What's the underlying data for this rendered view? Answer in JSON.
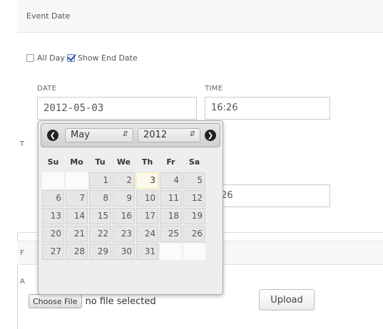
{
  "event_date_section": {
    "title": "Event Date",
    "all_day_label": "All Day",
    "all_day_checked": false,
    "show_end_date_label": "Show End Date",
    "show_end_date_checked": true
  },
  "date_field": {
    "label": "DATE",
    "value": "2012-05-03"
  },
  "time_field": {
    "label": "TIME",
    "value": "16:26"
  },
  "end_time_field": {
    "value_visible": "26"
  },
  "partial_labels": {
    "to": "T",
    "file_section": "F",
    "attachment": "A"
  },
  "file_upload": {
    "choose_label": "Choose File",
    "no_file_text": "no file selected",
    "upload_label": "Upload"
  },
  "datepicker": {
    "prev_icon": "prev-arrow-icon",
    "next_icon": "next-arrow-icon",
    "month": "May",
    "year": "2012",
    "weekdays": [
      "Su",
      "Mo",
      "Tu",
      "We",
      "Th",
      "Fr",
      "Sa"
    ],
    "weeks": [
      [
        "",
        "",
        "1",
        "2",
        "3",
        "4",
        "5"
      ],
      [
        "6",
        "7",
        "8",
        "9",
        "10",
        "11",
        "12"
      ],
      [
        "13",
        "14",
        "15",
        "16",
        "17",
        "18",
        "19"
      ],
      [
        "20",
        "21",
        "22",
        "23",
        "24",
        "25",
        "26"
      ],
      [
        "27",
        "28",
        "29",
        "30",
        "31",
        "",
        ""
      ]
    ],
    "today": "3"
  },
  "colors": {
    "header_bg": "#f7f7f7",
    "day_bg": "#e6e6e6",
    "today_bg": "#fbf9ee",
    "checkbox_check": "#2a5aa8"
  }
}
